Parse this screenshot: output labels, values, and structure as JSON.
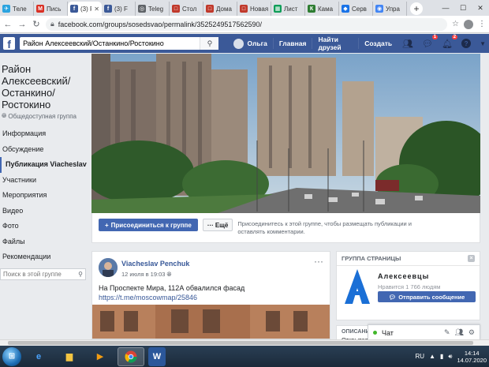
{
  "browser": {
    "tabs": [
      {
        "label": "Теле",
        "icon": "telegram-icon",
        "color": "#2aa3df",
        "glyph": "✈"
      },
      {
        "label": "Пись",
        "icon": "gmail-icon",
        "color": "#d93025",
        "glyph": "M"
      },
      {
        "label": "(3) F",
        "icon": "facebook-icon",
        "color": "#3b5998",
        "glyph": "f",
        "active": true
      },
      {
        "label": "(3) F",
        "icon": "facebook-icon",
        "color": "#3b5998",
        "glyph": "f"
      },
      {
        "label": "Teleg",
        "icon": "web-icon",
        "color": "#5f6368",
        "glyph": "◎"
      },
      {
        "label": "Стол",
        "icon": "page-icon",
        "color": "#c0392b",
        "glyph": "□"
      },
      {
        "label": "Дома",
        "icon": "page-icon",
        "color": "#c0392b",
        "glyph": "□"
      },
      {
        "label": "Новая вк",
        "icon": "page-icon",
        "color": "#c0392b",
        "glyph": "□"
      },
      {
        "label": "Лист",
        "icon": "sheets-icon",
        "color": "#0f9d58",
        "glyph": "▦"
      },
      {
        "label": "Кама",
        "icon": "kama-icon",
        "color": "#2e7d32",
        "glyph": "К"
      },
      {
        "label": "Серв",
        "icon": "maps-icon",
        "color": "#1a73e8",
        "glyph": "◆"
      },
      {
        "label": "Упра",
        "icon": "chrome-icon",
        "color": "#4285f4",
        "glyph": "◉"
      }
    ],
    "new_tab": "+",
    "url": "facebook.com/groups/sosedsvao/permalink/3525249517562590/"
  },
  "fb": {
    "search_value": "Район Алексеевский/Останкино/Ростокино",
    "user_name": "Ольга",
    "nav_home": "Главная",
    "nav_find_friends": "Найти друзей",
    "nav_create": "Создать",
    "badge_messages": "1",
    "badge_notifications": "2"
  },
  "group": {
    "title": "Район Алексеевский/ Останкино/ Ростокино",
    "type": "Общедоступная группа",
    "menu": [
      "Информация",
      "Обсуждение",
      "Публикация Viacheslav",
      "Участники",
      "Мероприятия",
      "Видео",
      "Фото",
      "Файлы",
      "Рекомендации"
    ],
    "active_menu_index": 2,
    "search_placeholder": "Поиск в этой группе"
  },
  "join": {
    "join_label": "Присоединиться к группе",
    "more_label": "Ещё",
    "hint": "Присоединитесь к этой группе, чтобы размещать публикации и оставлять комментарии."
  },
  "post": {
    "author": "Viacheslav Penchuk",
    "date": "12 июля в 19:03",
    "text": "На Проспекте Мира, 112А обвалился фасад",
    "link": "https://t.me/moscowmap/25846"
  },
  "page_card": {
    "header": "ГРУППА СТРАНИЦЫ",
    "name": "Алексеевцы",
    "likes": "Нравится 1 766 людям",
    "message_button": "Отправить сообщение"
  },
  "description": {
    "header": "ОПИСАНИЕ",
    "text": "Открытая группа ... информа"
  },
  "chat": {
    "label": "Чат"
  },
  "taskbar": {
    "language": "RU",
    "time": "14:14",
    "date": "14.07.2020"
  },
  "colors": {
    "fb_blue": "#3b5998",
    "button_blue": "#4267b2",
    "link_blue": "#385898"
  }
}
